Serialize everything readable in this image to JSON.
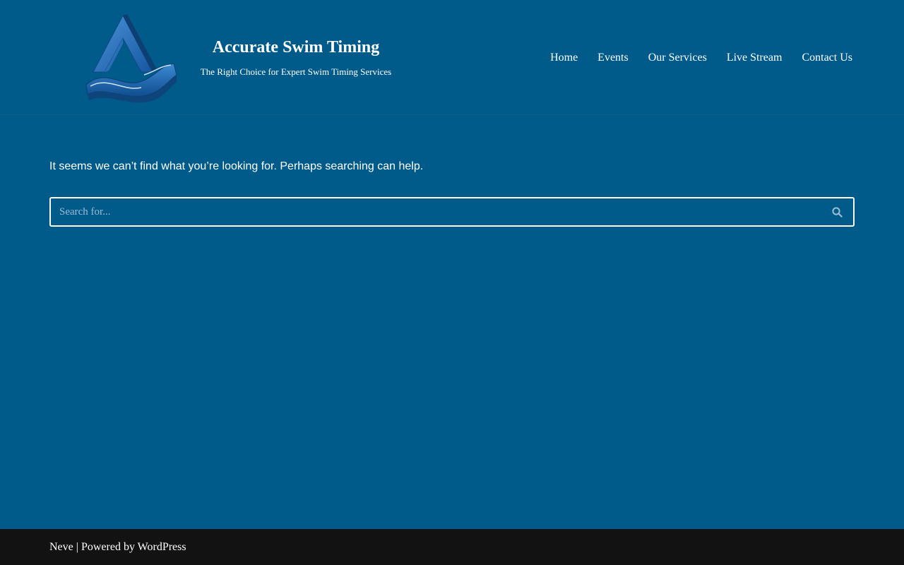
{
  "site": {
    "title": "Accurate Swim Timing",
    "tagline": "The Right Choice for Expert Swim Timing Services",
    "logo_icon": "swim-timing-logo"
  },
  "nav": {
    "items": [
      {
        "label": "Home"
      },
      {
        "label": "Events"
      },
      {
        "label": "Our Services"
      },
      {
        "label": "Live Stream"
      },
      {
        "label": "Contact Us"
      }
    ]
  },
  "main": {
    "message": "It seems we can’t find what you’re looking for. Perhaps searching can help.",
    "search": {
      "placeholder": "Search for...",
      "value": "",
      "button_icon": "search-icon"
    }
  },
  "footer": {
    "theme_link": "Neve",
    "separator": " | Powered by ",
    "platform_link": "WordPress"
  },
  "colors": {
    "background": "#005a8a",
    "footer_background": "#121212",
    "text": "#ffffff",
    "logo_blue": "#1d6fb8"
  }
}
